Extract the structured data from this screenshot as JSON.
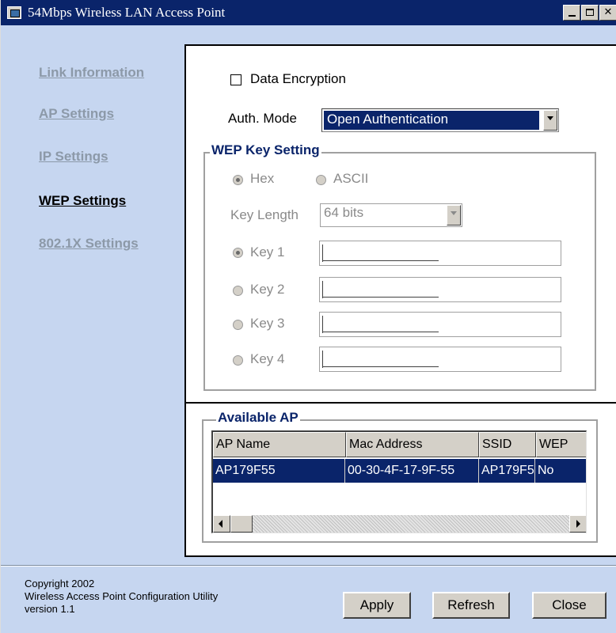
{
  "window": {
    "title": "54Mbps Wireless LAN Access Point"
  },
  "nav": {
    "items": [
      {
        "label": "Link Information",
        "active": false
      },
      {
        "label": "AP Settings",
        "active": false
      },
      {
        "label": "IP Settings",
        "active": false
      },
      {
        "label": "WEP Settings",
        "active": true
      },
      {
        "label": "802.1X Settings",
        "active": false
      }
    ]
  },
  "wep": {
    "data_encryption_label": "Data Encryption",
    "data_encryption_checked": false,
    "auth_mode_label": "Auth. Mode",
    "auth_mode_value": "Open Authentication",
    "group_title": "WEP Key Setting",
    "hex_label": "Hex",
    "ascii_label": "ASCII",
    "format_selected": "Hex",
    "key_length_label": "Key Length",
    "key_length_value": "64 bits",
    "keys": [
      {
        "label": "Key 1",
        "selected": true,
        "value": ""
      },
      {
        "label": "Key 2",
        "selected": false,
        "value": ""
      },
      {
        "label": "Key 3",
        "selected": false,
        "value": ""
      },
      {
        "label": "Key 4",
        "selected": false,
        "value": ""
      }
    ]
  },
  "available_ap": {
    "title": "Available AP",
    "columns": [
      "AP Name",
      "Mac Address",
      "SSID",
      "WEP"
    ],
    "rows": [
      {
        "ap_name": "AP179F55",
        "mac": "00-30-4F-17-9F-55",
        "ssid": "AP179F5",
        "wep": "No"
      }
    ]
  },
  "footer": {
    "copyright": "Copyright 2002",
    "product": "Wireless Access Point Configuration Utility",
    "version": "version 1.1",
    "apply_label": "Apply",
    "refresh_label": "Refresh",
    "close_label": "Close"
  },
  "colors": {
    "titlebar": "#0a246a",
    "background": "#c6d6f0",
    "selection": "#0a246a",
    "nav_inactive": "#8c99a8",
    "group_title": "#0a246a"
  }
}
